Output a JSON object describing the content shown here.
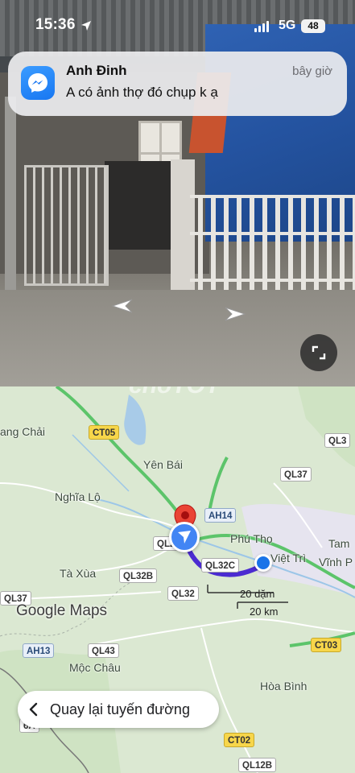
{
  "status_bar": {
    "time": "15:36",
    "network": "5G",
    "battery": "48"
  },
  "notification": {
    "app_icon": "messenger-icon",
    "sender": "Anh Đinh",
    "time": "bây giờ",
    "message": "A có ảnh thợ đó chụp k ạ"
  },
  "watermark": "choTỐT",
  "map": {
    "places": {
      "mu_cang_chai": "ang Chải",
      "yen_bai": "Yên Bái",
      "nghia_lo": "Nghĩa Lộ",
      "phu_tho": "Phú Thọ",
      "tam_dao": "Tam",
      "viet_tri": "Việt Trì",
      "vinh_phuc": "Vĩnh P",
      "ta_xua": "Tà Xùa",
      "moc_chau": "Mộc Châu",
      "hoa_binh": "Hòa Bình"
    },
    "roads": {
      "ct05": "CT05",
      "ql3": "QL3",
      "ql37_right": "QL37",
      "ah14": "AH14",
      "ql2": "QL2",
      "ql32c": "QL32C",
      "ql32b": "QL32B",
      "ql32": "QL32",
      "ql37_left": "QL37",
      "ah13": "AH13",
      "ql43": "QL43",
      "ct03": "CT03",
      "ct02": "CT02",
      "ql12b": "QL12B",
      "ql6": "6A"
    },
    "logo": "Google Maps",
    "scale_imperial": "20 dặm",
    "scale_metric": "20 km",
    "reroute_label": "Quay lại tuyến đường"
  },
  "colors": {
    "route": "#4b2bd1",
    "highway": "#5cc46a",
    "map_bg": "#dbe8d2",
    "messenger": "#1877f2"
  }
}
